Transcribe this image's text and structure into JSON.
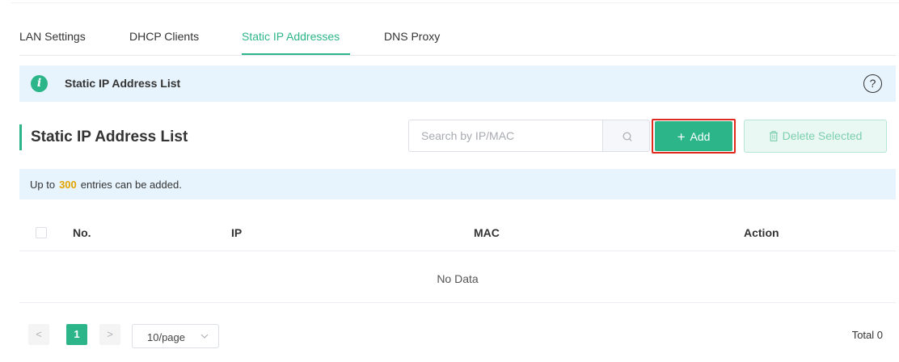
{
  "tabs": [
    {
      "label": "LAN Settings",
      "active": false
    },
    {
      "label": "DHCP Clients",
      "active": false
    },
    {
      "label": "Static IP Addresses",
      "active": true
    },
    {
      "label": "DNS Proxy",
      "active": false
    }
  ],
  "info_bar": {
    "icon": "info-icon",
    "icon_glyph": "i",
    "title": "Static IP Address List",
    "help_glyph": "?"
  },
  "section": {
    "title": "Static IP Address List",
    "search_placeholder": "Search by IP/MAC",
    "search_value": "",
    "add_icon": "plus-icon",
    "add_glyph": "+",
    "add_label": "Add",
    "delete_icon": "trash-icon",
    "delete_label": "Delete Selected"
  },
  "limit": {
    "prefix": "Up to",
    "count": "300",
    "suffix": "entries can be added."
  },
  "table": {
    "columns": [
      "No.",
      "IP",
      "MAC",
      "Action"
    ],
    "rows": [],
    "empty_text": "No Data"
  },
  "pagination": {
    "prev_glyph": "<",
    "next_glyph": ">",
    "current_page": "1",
    "page_size": "10/page",
    "total": "Total 0"
  },
  "colors": {
    "accent": "#2db58a",
    "info_bg": "#e7f4fd",
    "highlight": "#e1291f",
    "count": "#e2a400"
  }
}
